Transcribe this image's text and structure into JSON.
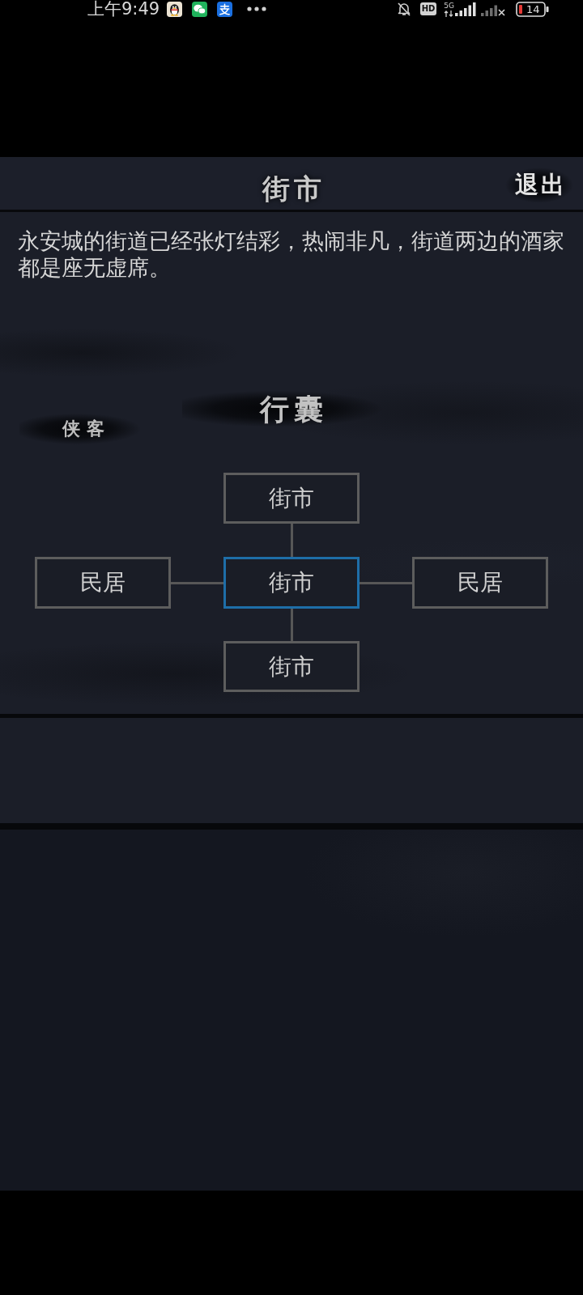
{
  "status_bar": {
    "time": "上午9:49",
    "hd_badge": "HD",
    "network": "5G",
    "battery": "14"
  },
  "header": {
    "title": "街市",
    "exit_button": "退出"
  },
  "scene": {
    "description": "永安城的街道已经张灯结彩，热闹非凡，街道两边的酒家都是座无虚席。"
  },
  "nav": {
    "hero": "侠客",
    "pack": "行囊"
  },
  "map": {
    "north": {
      "label": "街市",
      "selected": false
    },
    "west": {
      "label": "民居",
      "selected": false
    },
    "center": {
      "label": "街市",
      "selected": true
    },
    "east": {
      "label": "民居",
      "selected": false
    },
    "south": {
      "label": "街市",
      "selected": false
    }
  }
}
